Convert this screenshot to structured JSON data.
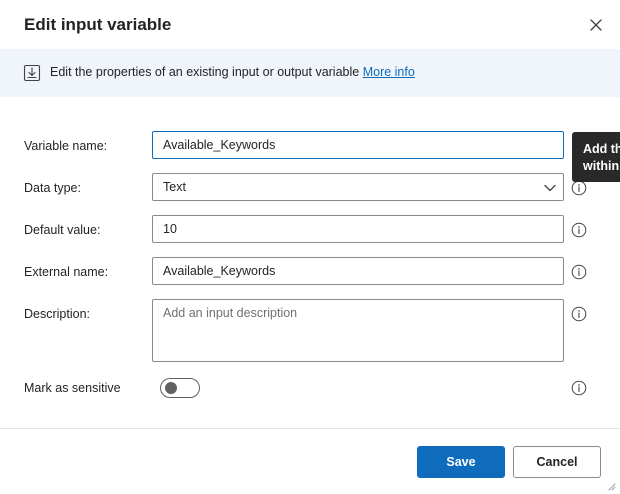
{
  "dialog": {
    "title": "Edit input variable"
  },
  "banner": {
    "text": "Edit the properties of an existing input or output variable",
    "link": "More info"
  },
  "form": {
    "variable_name": {
      "label": "Variable name:",
      "value": "Available_Keywords"
    },
    "data_type": {
      "label": "Data type:",
      "value": "Text"
    },
    "default_value": {
      "label": "Default value:",
      "value": "10"
    },
    "external_name": {
      "label": "External name:",
      "value": "Available_Keywords"
    },
    "description": {
      "label": "Description:",
      "placeholder": "Add an input description"
    },
    "sensitive": {
      "label": "Mark as sensitive",
      "on": false
    }
  },
  "tooltip": {
    "line1": "Add the",
    "line2": "within t"
  },
  "footer": {
    "save_label": "Save",
    "cancel_label": "Cancel"
  },
  "colors": {
    "accent": "#0f6cbd",
    "banner_bg": "#eff5fb",
    "tooltip_bg": "#292929"
  }
}
